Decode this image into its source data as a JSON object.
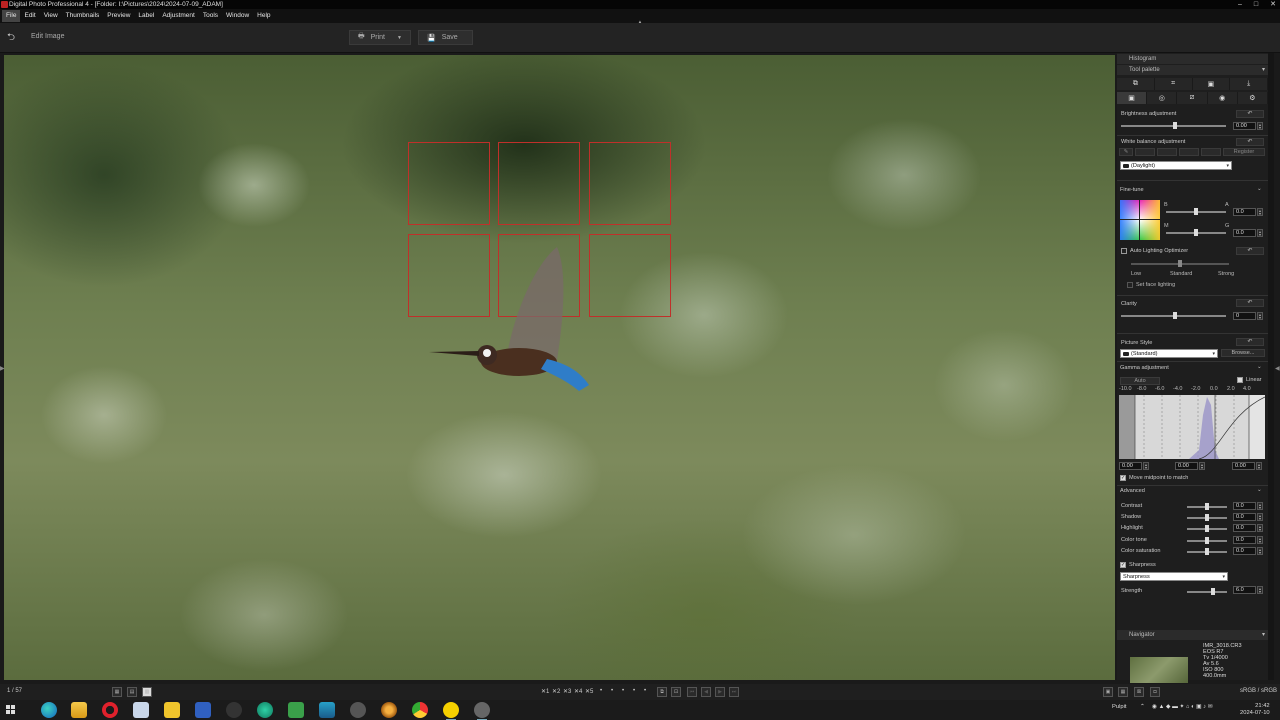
{
  "window": {
    "title": "Digital Photo Professional 4 - [Folder: I:\\Pictures\\2024\\2024-07-09_ADAM]",
    "controls": [
      "–",
      "□",
      "✕"
    ]
  },
  "menu": [
    "File",
    "Edit",
    "View",
    "Thumbnails",
    "Preview",
    "Label",
    "Adjustment",
    "Tools",
    "Window",
    "Help"
  ],
  "toolbar": {
    "mode_label": "Edit Image",
    "print_label": "Print",
    "save_label": "Save"
  },
  "panel": {
    "histogram_title": "Histogram",
    "tool_palette_title": "Tool palette",
    "brightness": {
      "label": "Brightness adjustment",
      "value": "0.00",
      "level": 0.5
    },
    "white_balance": {
      "label": "White balance adjustment",
      "preset": "(Daylight)",
      "register_label": "Register"
    },
    "fine_tune": {
      "label": "Fine-tune",
      "b_label": "B",
      "a_label": "A",
      "m_label": "M",
      "g_label": "G",
      "ba_value": "0.0",
      "mg_value": "0.0"
    },
    "alo": {
      "label": "Auto Lighting Optimizer",
      "low": "Low",
      "standard": "Standard",
      "strong": "Strong",
      "face_label": "Set face lighting"
    },
    "clarity": {
      "label": "Clarity",
      "value": "0",
      "level": 0.5
    },
    "picture_style": {
      "label": "Picture Style",
      "value": "(Standard)",
      "browse_label": "Browse..."
    },
    "gamma": {
      "label": "Gamma adjustment",
      "auto_label": "Auto",
      "linear_label": "Linear",
      "ticks": [
        "-10.0",
        "-8.0",
        "-6.0",
        "-4.0",
        "-2.0",
        "0.0",
        "2.0",
        "4.0"
      ],
      "left_value": "0.00",
      "mid_value": "0.00",
      "right_value": "0.00",
      "midpoint_label": "Move midpoint to match"
    },
    "advanced": {
      "label": "Advanced",
      "rows": [
        {
          "label": "Contrast",
          "value": "0.0"
        },
        {
          "label": "Shadow",
          "value": "0.0"
        },
        {
          "label": "Highlight",
          "value": "0.0"
        },
        {
          "label": "Color tone",
          "value": "0.0"
        },
        {
          "label": "Color saturation",
          "value": "0.0"
        }
      ]
    },
    "sharpness": {
      "label": "Sharpness",
      "mode": "Sharpness",
      "strength_label": "Strength",
      "strength_value": "6.0"
    }
  },
  "navigator": {
    "title": "Navigator",
    "info": [
      "IMR_3018.CR3",
      "EOS R7",
      "Tv 1/4000",
      "Av 5.6",
      "ISO 800",
      "400.0mm"
    ]
  },
  "status": {
    "count": "1 / 57",
    "rating_marks": [
      "✕1",
      "✕2",
      "✕3",
      "✕4",
      "✕5"
    ],
    "stars": [
      "•",
      "•",
      "•",
      "•",
      "•"
    ],
    "color_space": "sRGB / sRGB"
  },
  "taskbar": {
    "apps": [
      "edge",
      "explorer",
      "opera",
      "notes",
      "batman",
      "floppy",
      "inkscape",
      "app-teal",
      "app-green",
      "app-box",
      "app-penguin",
      "app-eye",
      "chrome",
      "norton",
      "app-dpp"
    ],
    "tray_label": "Pulpit",
    "time": "21:42",
    "date": "2024-07-10"
  },
  "colors": {
    "af_frame": "#c0302a",
    "panel_bg": "#1e1e1e",
    "accent": "#7ab"
  }
}
